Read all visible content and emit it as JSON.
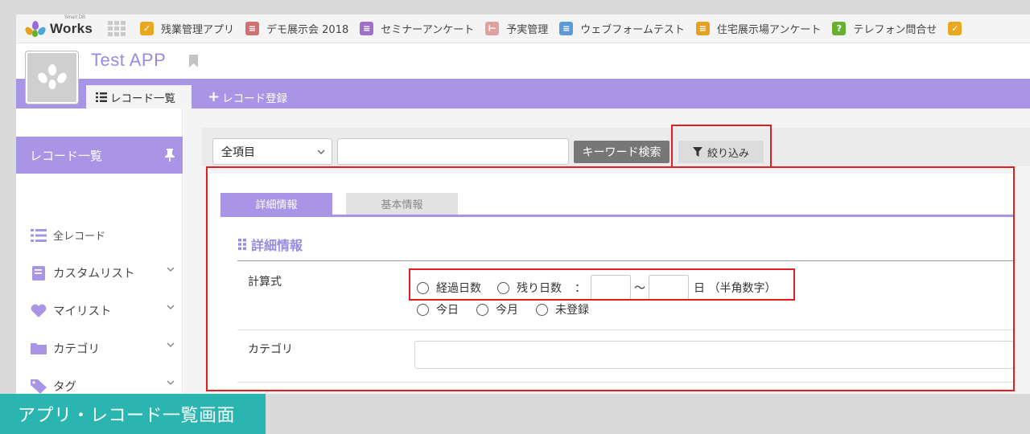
{
  "topbar": {
    "logo_small": "Smart DB",
    "logo_text": "Works",
    "apps": [
      {
        "label": "残業管理アプリ",
        "icon": "checkbox-icon",
        "color": "#e8a820",
        "glyph": "✓"
      },
      {
        "label": "デモ展示会 2018",
        "icon": "document-icon",
        "color": "#d07070",
        "glyph": "≡"
      },
      {
        "label": "セミナーアンケート",
        "icon": "document-icon",
        "color": "#a070c8",
        "glyph": "≡"
      },
      {
        "label": "予実管理",
        "icon": "gantt-icon",
        "color": "#e0a0a0",
        "glyph": "⊢"
      },
      {
        "label": "ウェブフォームテスト",
        "icon": "list-icon",
        "color": "#5a9ad8",
        "glyph": "≡"
      },
      {
        "label": "住宅展示場アンケート",
        "icon": "note-icon",
        "color": "#e8a020",
        "glyph": "≡"
      },
      {
        "label": "テレフォン問合せ",
        "icon": "question-icon",
        "color": "#6ab030",
        "glyph": "?"
      },
      {
        "label": "",
        "icon": "checkbox-icon",
        "color": "#e8a820",
        "glyph": "✓"
      }
    ]
  },
  "header": {
    "app_title": "Test APP",
    "tab_list": "レコード一覧",
    "tab_add": "レコード登録"
  },
  "sidebar": {
    "head": "レコード一覧",
    "all_records": "全レコード",
    "items": [
      {
        "label": "カスタムリスト"
      },
      {
        "label": "マイリスト"
      },
      {
        "label": "カテゴリ"
      },
      {
        "label": "タグ"
      }
    ]
  },
  "search": {
    "field_select": "全項目",
    "keyword_value": "",
    "keyword_button": "キーワード検索",
    "filter_button": "絞り込み"
  },
  "panel": {
    "tab_detail": "詳細情報",
    "tab_basic": "基本情報",
    "section_title": "詳細情報",
    "calc_label": "計算式",
    "opt_elapsed": "経過日数",
    "opt_remaining": "残り日数",
    "colon": "：",
    "tilde": "〜",
    "unit": "日 （半角数字）",
    "opt_today": "今日",
    "opt_month": "今月",
    "opt_unregistered": "未登録",
    "category_label": "カテゴリ"
  },
  "caption": "アプリ・レコード一覧画面",
  "colors": {
    "accent": "#a995e6",
    "highlight": "#e02020",
    "caption_bg": "#2bb5b0"
  }
}
